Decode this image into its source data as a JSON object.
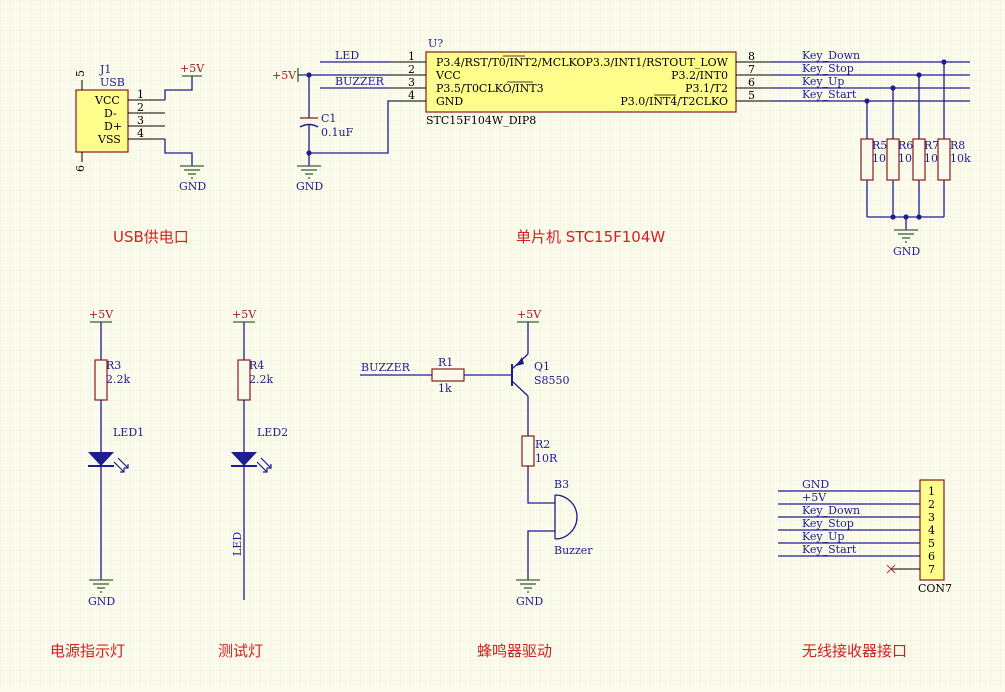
{
  "sections": {
    "usb": "USB供电口",
    "mcu": "单片机 STC15F104W",
    "power_led": "电源指示灯",
    "test_led": "测试灯",
    "buzzer": "蜂鸣器驱动",
    "receiver": "无线接收器接口"
  },
  "power": {
    "vcc": "+5V",
    "gnd": "GND"
  },
  "j1": {
    "ref": "J1",
    "name": "USB",
    "pins": [
      "VCC",
      "D-",
      "D+",
      "VSS"
    ],
    "pin_numbers": [
      "1",
      "2",
      "3",
      "4"
    ],
    "shell_pins": [
      "5",
      "6"
    ]
  },
  "u1": {
    "ref": "U?",
    "part": "STC15F104W_DIP8",
    "left_pins": [
      "P3.4/RST/T0/INT2/MCLKO",
      "VCC",
      "P3.5/T0CLKO/INT3",
      "GND"
    ],
    "left_numbers": [
      "1",
      "2",
      "3",
      "4"
    ],
    "right_pins": [
      "P3.3/INT1/RSTOUT_LOW",
      "P3.2/INT0",
      "P3.1/T2",
      "P3.0/INT4/T2CLKO"
    ],
    "right_numbers": [
      "8",
      "7",
      "6",
      "5"
    ]
  },
  "c1": {
    "ref": "C1",
    "value": "0.1uF"
  },
  "nets": {
    "led": "LED",
    "buzzer": "BUZZER",
    "key_down": "Key_Down",
    "key_stop": "Key_Stop",
    "key_up": "Key_Up",
    "key_start": "Key_Start"
  },
  "pullups": [
    {
      "ref": "R5",
      "value": "10k"
    },
    {
      "ref": "R6",
      "value": "10k"
    },
    {
      "ref": "R7",
      "value": "10k"
    },
    {
      "ref": "R8",
      "value": "10k"
    }
  ],
  "led1": {
    "res_ref": "R3",
    "res_value": "2.2k",
    "led_ref": "LED1"
  },
  "led2": {
    "res_ref": "R4",
    "res_value": "2.2k",
    "led_ref": "LED2"
  },
  "buzzer_driver": {
    "r1_ref": "R1",
    "r1_value": "1k",
    "q_ref": "Q1",
    "q_part": "S8550",
    "r2_ref": "R2",
    "r2_value": "10R",
    "b_ref": "B3",
    "b_part": "Buzzer"
  },
  "con7": {
    "ref": "CON7",
    "nets": [
      "GND",
      "+5V",
      "Key_Down",
      "Key_Stop",
      "Key_Up",
      "Key_Start"
    ],
    "pin_numbers": [
      "1",
      "2",
      "3",
      "4",
      "5",
      "6",
      "7"
    ]
  }
}
